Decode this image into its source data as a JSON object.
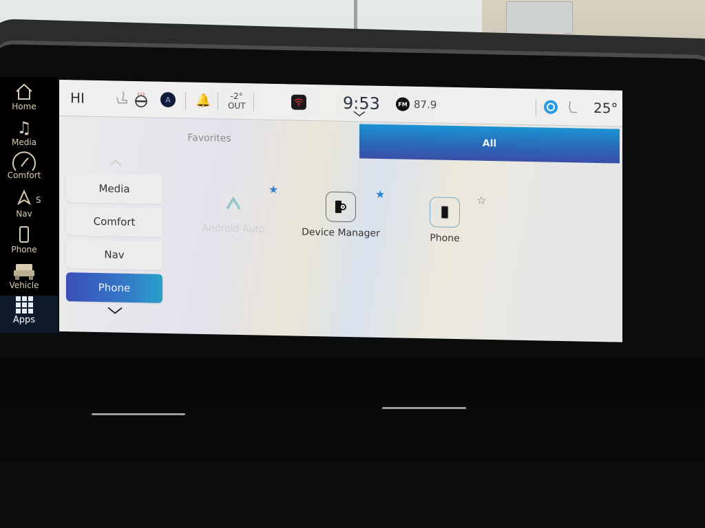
{
  "rail": {
    "items": [
      {
        "label": "Home",
        "icon": "home-icon",
        "glyph": "⌂"
      },
      {
        "label": "Media",
        "icon": "music-note-icon",
        "glyph": "♫"
      },
      {
        "label": "Comfort",
        "icon": "comfort-seat-icon",
        "glyph": "◔"
      },
      {
        "label": "Nav",
        "icon": "nav-arrow-icon",
        "glyph": "A"
      },
      {
        "label": "Phone",
        "icon": "phone-icon",
        "glyph": "▯"
      },
      {
        "label": "Vehicle",
        "icon": "vehicle-icon",
        "glyph": "⛟"
      },
      {
        "label": "Apps",
        "icon": "apps-grid-icon",
        "glyph": "▦"
      }
    ],
    "compass": "S",
    "active": "Apps"
  },
  "statusbar": {
    "hvac_setting": "HI",
    "driver_icon": "A",
    "outside_temp": "-2°",
    "outside_label": "OUT",
    "time": "9:53",
    "radio_band": "FM",
    "radio_freq": "87.9",
    "cabin_temp": "25°"
  },
  "tabs": [
    {
      "label": "Favorites",
      "active": false
    },
    {
      "label": "All",
      "active": true
    }
  ],
  "categories": [
    {
      "label": "Media",
      "active": false
    },
    {
      "label": "Comfort",
      "active": false
    },
    {
      "label": "Nav",
      "active": false
    },
    {
      "label": "Phone",
      "active": true
    }
  ],
  "apps": [
    {
      "label": "Android Auto",
      "favorite": true,
      "enabled": false
    },
    {
      "label": "Device Manager",
      "favorite": true,
      "enabled": true
    },
    {
      "label": "Phone",
      "favorite": false,
      "enabled": true
    }
  ],
  "colors": {
    "accent": "#2c84d6",
    "active_tab": "#2b66b8",
    "rail_text": "#d8cdb2"
  }
}
